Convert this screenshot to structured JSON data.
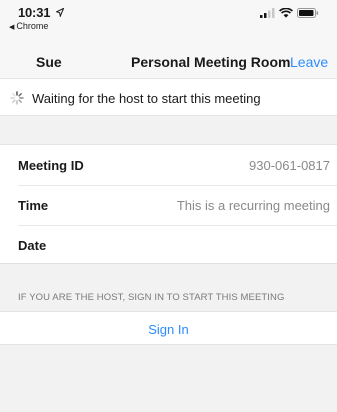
{
  "status_bar": {
    "time": "10:31",
    "back_app": "Chrome",
    "icons": [
      "location-arrow-icon",
      "cellular-signal-icon",
      "wifi-icon",
      "battery-icon"
    ]
  },
  "nav": {
    "user": "Sue",
    "title": "Personal Meeting Room",
    "leave_label": "Leave"
  },
  "waiting": {
    "text": "Waiting for the host to start this meeting"
  },
  "details": [
    {
      "label": "Meeting ID",
      "value": "930-061-0817"
    },
    {
      "label": "Time",
      "value": "This is a recurring meeting"
    },
    {
      "label": "Date",
      "value": ""
    }
  ],
  "host_note": "IF YOU ARE THE HOST, SIGN IN TO START THIS MEETING",
  "sign_in_label": "Sign In",
  "colors": {
    "accent": "#2d8cff",
    "background": "#f2f2f2",
    "muted_text": "#8a8a8a"
  }
}
